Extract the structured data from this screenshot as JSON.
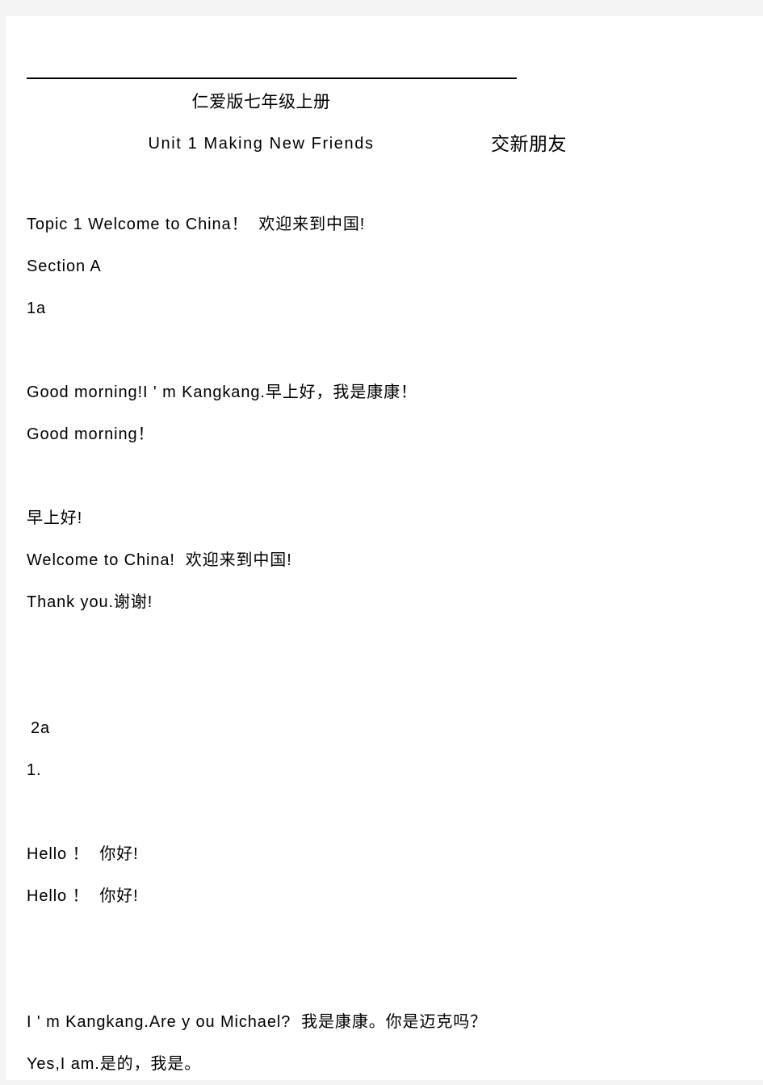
{
  "document": {
    "title_cn": "仁爱版七年级上册",
    "unit_en": "Unit 1 Making New Friends",
    "unit_cn": "交新朋友"
  },
  "body_lines": [
    {
      "id": "topic",
      "text": "Topic 1 Welcome to China！  欢迎来到中国!"
    },
    {
      "id": "section",
      "text": "Section A"
    },
    {
      "id": "label-1a",
      "text": "1a"
    },
    {
      "id": "blank-1",
      "text": ""
    },
    {
      "id": "good-morning-1",
      "text": "Good morning!I ' m Kangkang.早上好，我是康康！"
    },
    {
      "id": "good-morning-2",
      "text": "Good morning！"
    },
    {
      "id": "blank-2",
      "text": ""
    },
    {
      "id": "zaoshang-hao",
      "text": "早上好!"
    },
    {
      "id": "welcome-china",
      "text": "Welcome to China!  欢迎来到中国!"
    },
    {
      "id": "thank-you",
      "text": "Thank you.谢谢!"
    },
    {
      "id": "blank-3",
      "text": ""
    },
    {
      "id": "blank-4",
      "text": ""
    },
    {
      "id": "label-2a",
      "text": "2a"
    },
    {
      "id": "item-1",
      "text": "1."
    },
    {
      "id": "blank-5",
      "text": ""
    },
    {
      "id": "hello-1",
      "text": "Hello ！  你好!"
    },
    {
      "id": "hello-2",
      "text": "Hello ！  你好!"
    },
    {
      "id": "blank-6",
      "text": ""
    },
    {
      "id": "blank-7",
      "text": ""
    },
    {
      "id": "are-you-michael",
      "text": "I ' m Kangkang.Are y ou Michael?  我是康康。你是迈克吗？"
    },
    {
      "id": "yes-i-am",
      "text": "Yes,I am.是的，我是。"
    }
  ],
  "colors": {
    "page_background": "#ffffff",
    "gutter": "#f4f4f4",
    "text": "#000000",
    "rule": "#000000"
  }
}
